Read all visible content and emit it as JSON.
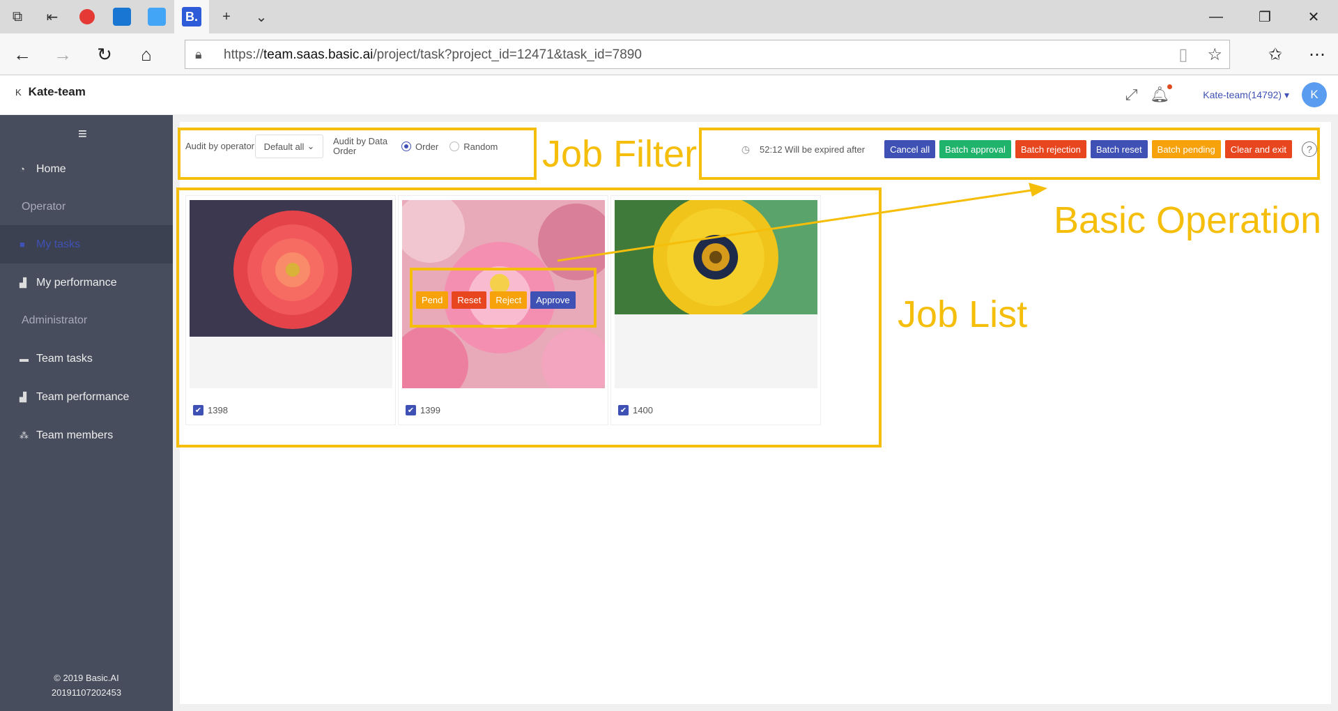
{
  "browser": {
    "url_prefix": "https://",
    "url_domain": "team.saas.basic.ai",
    "url_path": "/project/task?project_id=12471&task_id=7890",
    "active_tab_glyph": "B."
  },
  "header": {
    "team_initial": "K",
    "team_name": "Kate-team",
    "user_label": "Kate-team(14792)",
    "avatar_letter": "K"
  },
  "sidebar": {
    "items": [
      {
        "label": "Home"
      },
      {
        "label": "Operator"
      },
      {
        "label": "My tasks"
      },
      {
        "label": "My performance"
      },
      {
        "label": "Administrator"
      },
      {
        "label": "Team tasks"
      },
      {
        "label": "Team performance"
      },
      {
        "label": "Team members"
      }
    ],
    "copyright": "© 2019 Basic.AI",
    "build": "20191107202453"
  },
  "filter": {
    "audit_operator_label": "Audit by operator",
    "audit_operator_value": "Default all",
    "audit_data_order_label": "Audit by Data Order",
    "order_label": "Order",
    "random_label": "Random"
  },
  "operations": {
    "timer_text": "52:12 Will be expired after",
    "cancel_all": "Cancel all",
    "batch_approval": "Batch approval",
    "batch_rejection": "Batch rejection",
    "batch_reset": "Batch reset",
    "batch_pending": "Batch pending",
    "clear_exit": "Clear and exit",
    "help": "?"
  },
  "jobs": [
    {
      "id": "1398"
    },
    {
      "id": "1399"
    },
    {
      "id": "1400"
    }
  ],
  "card_actions": {
    "pend": "Pend",
    "reset": "Reset",
    "reject": "Reject",
    "approve": "Approve"
  },
  "annotations": {
    "job_filter": "Job Filter",
    "basic_operation": "Basic Operation",
    "job_list": "Job List"
  },
  "colors": {
    "primary": "#3f51b5",
    "success": "#1fb36b",
    "danger": "#e8461f",
    "warning": "#f7a20a",
    "annotation": "#f5be0b",
    "sidebar_bg": "#474d5c"
  }
}
